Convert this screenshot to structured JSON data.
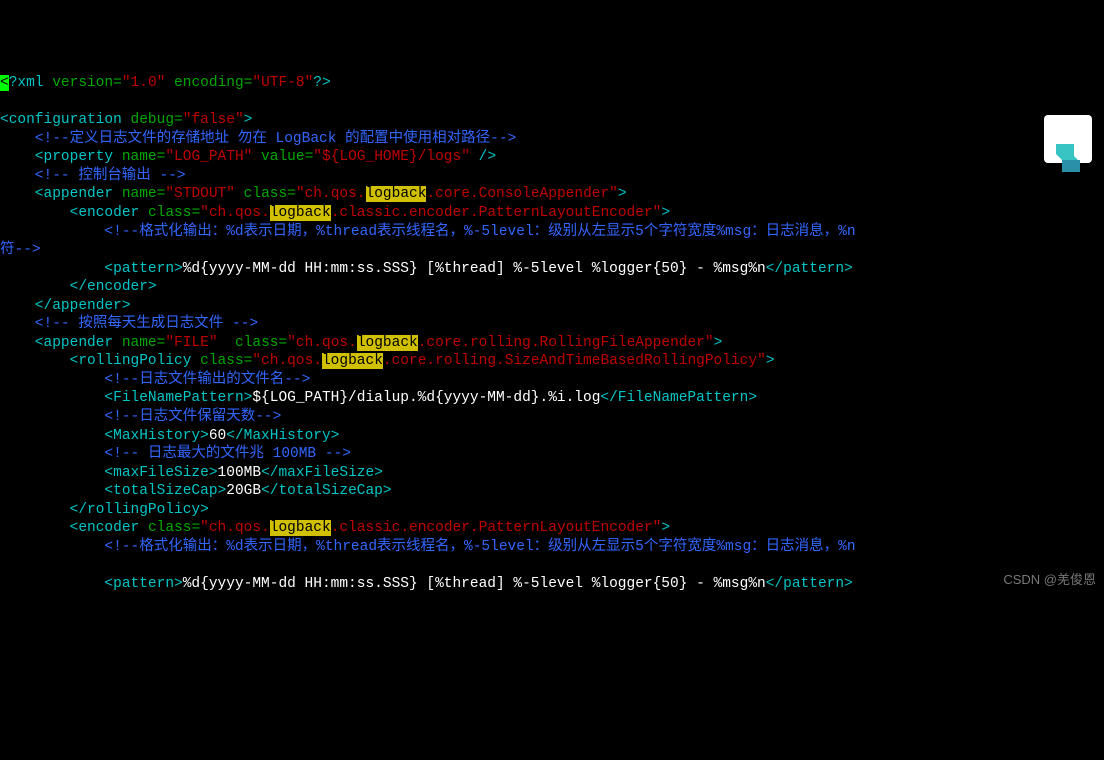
{
  "l1_prolog_hl": "<",
  "l1_prolog": "?xml ",
  "l1_version_attr": "version=",
  "l1_version_val": "\"1.0\"",
  "l1_encoding_attr": " encoding=",
  "l1_encoding_val": "\"UTF-8\"",
  "l1_end": "?>",
  "l3_open": "<configuration ",
  "l3_debug_attr": "debug=",
  "l3_debug_val": "\"false\"",
  "l3_close": ">",
  "l4_c": "    <!--定义日志文件的存储地址 勿在 LogBack 的配置中使用相对路径-->",
  "l5_prop_open": "    <property ",
  "l5_name_attr": "name=",
  "l5_name_val": "\"LOG_PATH\"",
  "l5_value_attr": " value=",
  "l5_value_val": "\"${LOG_HOME}/logs\"",
  "l5_close": " />",
  "l6_c": "    <!-- 控制台输出 -->",
  "l7_open": "    <appender ",
  "l7_name_attr": "name=",
  "l7_name_val": "\"STDOUT\"",
  "l7_class_attr": " class=",
  "l7_class_val_a": "\"ch.qos.",
  "l7_class_hl": "logback",
  "l7_class_val_b": ".core.ConsoleAppender\"",
  "l7_close": ">",
  "l8_open": "        <encoder ",
  "l8_class_attr": "class=",
  "l8_class_val_a": "\"ch.qos.",
  "l8_class_hl": "logback",
  "l8_class_val_b": ".classic.encoder.PatternLayoutEncoder\"",
  "l8_close": ">",
  "l9_c": "            <!--格式化输出：%d表示日期，%thread表示线程名，%-5level：级别从左显示5个字符宽度%msg：日志消息，%n",
  "l9_c2": "符-->",
  "l11_open": "            <pattern>",
  "l11_txt": "%d{yyyy-MM-dd HH:mm:ss.SSS} [%thread] %-5level %logger{50} - %msg%n",
  "l11_close": "</pattern>",
  "l12_close": "        </encoder>",
  "l13_close": "    </appender>",
  "l14_c": "    <!-- 按照每天生成日志文件 -->",
  "l15_open": "    <appender ",
  "l15_name_attr": "name=",
  "l15_name_val": "\"FILE\"",
  "l15_class_attr": "  class=",
  "l15_class_val_a": "\"ch.qos.",
  "l15_class_hl": "logback",
  "l15_class_val_b": ".core.rolling.RollingFileAppender\"",
  "l15_close": ">",
  "l16_open": "        <rollingPolicy ",
  "l16_class_attr": "class=",
  "l16_class_val_a": "\"ch.qos.",
  "l16_class_hl": "logback",
  "l16_class_val_b": ".core.rolling.SizeAndTimeBasedRollingPolicy\"",
  "l16_close": ">",
  "l17_c": "            <!--日志文件输出的文件名-->",
  "l18_open": "            <FileNamePattern>",
  "l18_txt": "${LOG_PATH}/dialup.%d{yyyy-MM-dd}.%i.log",
  "l18_close": "</FileNamePattern>",
  "l19_c": "            <!--日志文件保留天数-->",
  "l20_open": "            <MaxHistory>",
  "l20_txt": "60",
  "l20_close": "</MaxHistory>",
  "l21_c": "            <!-- 日志最大的文件兆 100MB -->",
  "l22_open": "            <maxFileSize>",
  "l22_txt": "100MB",
  "l22_close": "</maxFileSize>",
  "l23_open": "            <totalSizeCap>",
  "l23_txt": "20GB",
  "l23_close": "</totalSizeCap>",
  "l24_close": "        </rollingPolicy>",
  "l25_open": "        <encoder ",
  "l25_class_attr": "class=",
  "l25_class_val_a": "\"ch.qos.",
  "l25_class_hl": "logback",
  "l25_class_val_b": ".classic.encoder.PatternLayoutEncoder\"",
  "l25_close": ">",
  "l26_c": "            <!--格式化输出：%d表示日期，%thread表示线程名，%-5level：级别从左显示5个字符宽度%msg：日志消息，%n",
  "l28_open": "            <pattern>",
  "l28_txt": "%d{yyyy-MM-dd HH:mm:ss.SSS} [%thread] %-5level %logger{50} - %msg%n",
  "l28_close": "</pattern>",
  "watermark": "CSDN @羌俊恩"
}
